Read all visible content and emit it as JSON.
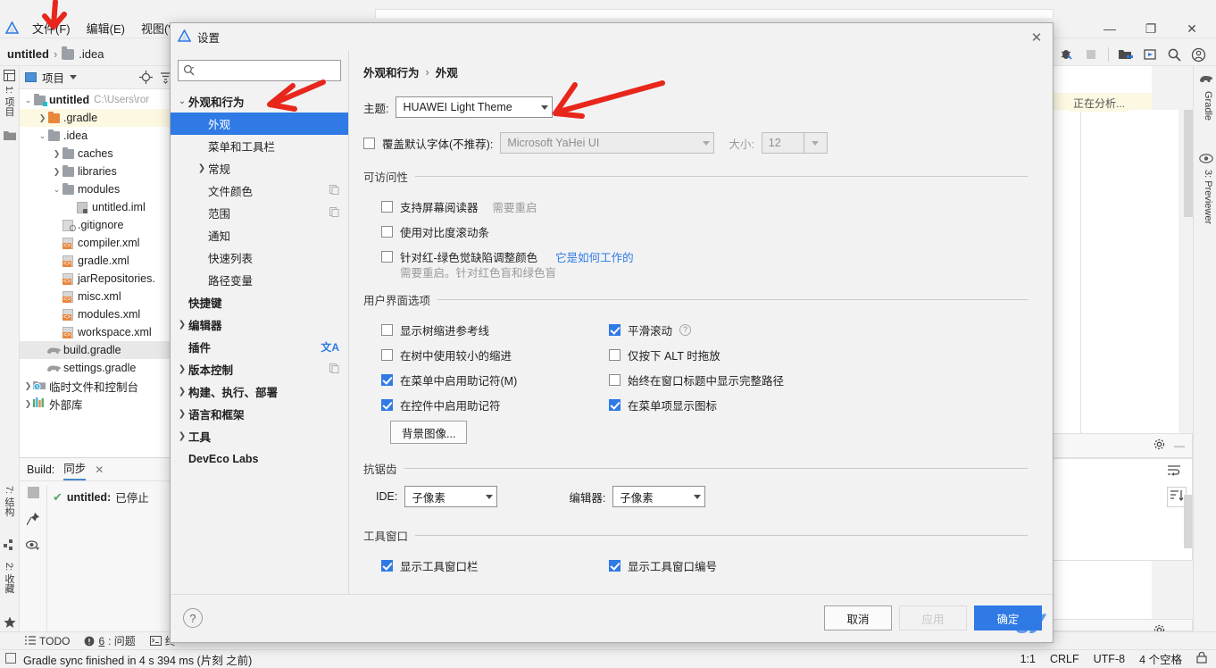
{
  "app": {
    "menus": [
      "文件(F)",
      "编辑(E)",
      "视图(V)"
    ],
    "breadcrumb": {
      "project": "untitled",
      "sep": "›",
      "folder": ".idea"
    },
    "window_controls": {
      "minimize": "—",
      "maximize": "❐",
      "close": "✕"
    }
  },
  "left_strip": {
    "tabs": [
      "1: 项目",
      "7: 结构",
      "2: 收藏"
    ]
  },
  "project_panel": {
    "title": "项目",
    "tree": [
      {
        "label": "untitled",
        "sub": "C:\\Users\\ror",
        "depth": 0,
        "arrow": "v",
        "icon": "folder-module",
        "bold": true
      },
      {
        "label": ".gradle",
        "depth": 1,
        "arrow": ">",
        "icon": "folder-orange",
        "highlight": true
      },
      {
        "label": ".idea",
        "depth": 1,
        "arrow": "v",
        "icon": "folder"
      },
      {
        "label": "caches",
        "depth": 2,
        "arrow": ">",
        "icon": "folder"
      },
      {
        "label": "libraries",
        "depth": 2,
        "arrow": ">",
        "icon": "folder"
      },
      {
        "label": "modules",
        "depth": 2,
        "arrow": "v",
        "icon": "folder"
      },
      {
        "label": "untitled.iml",
        "depth": 3,
        "arrow": "",
        "icon": "module"
      },
      {
        "label": ".gitignore",
        "depth": 2,
        "arrow": "",
        "icon": "file"
      },
      {
        "label": "compiler.xml",
        "depth": 2,
        "arrow": "",
        "icon": "xml"
      },
      {
        "label": "gradle.xml",
        "depth": 2,
        "arrow": "",
        "icon": "xml"
      },
      {
        "label": "jarRepositories.",
        "depth": 2,
        "arrow": "",
        "icon": "xml"
      },
      {
        "label": "misc.xml",
        "depth": 2,
        "arrow": "",
        "icon": "xml"
      },
      {
        "label": "modules.xml",
        "depth": 2,
        "arrow": "",
        "icon": "xml"
      },
      {
        "label": "workspace.xml",
        "depth": 2,
        "arrow": "",
        "icon": "xml"
      },
      {
        "label": "build.gradle",
        "depth": 1,
        "arrow": "",
        "icon": "gradle",
        "selected": true
      },
      {
        "label": "settings.gradle",
        "depth": 1,
        "arrow": "",
        "icon": "gradle"
      },
      {
        "label": "临时文件和控制台",
        "depth": 0,
        "arrow": ">",
        "icon": "scratch"
      },
      {
        "label": "外部库",
        "depth": 0,
        "arrow": ">",
        "icon": "lib"
      }
    ]
  },
  "build_panel": {
    "title": "Build:",
    "tab": "同步",
    "close": "✕",
    "result": {
      "name": "untitled:",
      "status": "已停止"
    }
  },
  "editor": {
    "analyzing": "正在分析..."
  },
  "right_strip": {
    "tabs": [
      "Gradle",
      "3: Previewer"
    ]
  },
  "status_bar_tools": {
    "todo": "TODO",
    "problems": {
      "count": "6",
      "label": ": 问题"
    },
    "terminal": "终"
  },
  "status_bar": {
    "message": "Gradle sync finished in 4 s 394 ms (片刻 之前)",
    "caret": "1:1",
    "line_sep": "CRLF",
    "encoding": "UTF-8",
    "indent": "4 个空格"
  },
  "dialog": {
    "title": "设置",
    "close": "✕",
    "search": {
      "placeholder": "",
      "value": ""
    },
    "nav": [
      {
        "label": "外观和行为",
        "arrow": "v",
        "indent": 0,
        "bold": true
      },
      {
        "label": "外观",
        "arrow": "",
        "indent": 1,
        "selected": true
      },
      {
        "label": "菜单和工具栏",
        "arrow": "",
        "indent": 1
      },
      {
        "label": "常规",
        "arrow": ">",
        "indent": 1
      },
      {
        "label": "文件颜色",
        "arrow": "",
        "indent": 1,
        "badge": "copy"
      },
      {
        "label": "范围",
        "arrow": "",
        "indent": 1,
        "badge": "copy"
      },
      {
        "label": "通知",
        "arrow": "",
        "indent": 1
      },
      {
        "label": "快速列表",
        "arrow": "",
        "indent": 1
      },
      {
        "label": "路径变量",
        "arrow": "",
        "indent": 1
      },
      {
        "label": "快捷键",
        "arrow": "",
        "indent": 0,
        "bold": true
      },
      {
        "label": "编辑器",
        "arrow": ">",
        "indent": 0,
        "bold": true
      },
      {
        "label": "插件",
        "arrow": "",
        "indent": 0,
        "bold": true,
        "badge": "translate"
      },
      {
        "label": "版本控制",
        "arrow": ">",
        "indent": 0,
        "bold": true,
        "badge": "copy"
      },
      {
        "label": "构建、执行、部署",
        "arrow": ">",
        "indent": 0,
        "bold": true
      },
      {
        "label": "语言和框架",
        "arrow": ">",
        "indent": 0,
        "bold": true
      },
      {
        "label": "工具",
        "arrow": ">",
        "indent": 0,
        "bold": true
      },
      {
        "label": "DevEco Labs",
        "arrow": "",
        "indent": 0,
        "bold": true
      }
    ],
    "breadcrumb": {
      "parent": "外观和行为",
      "sep": "›",
      "current": "外观"
    },
    "theme": {
      "label": "主题:",
      "value": "HUAWEI Light Theme"
    },
    "override_font": {
      "checkbox_label": "覆盖默认字体(不推荐):",
      "checked": false,
      "font_value": "Microsoft YaHei UI",
      "size_label": "大小:",
      "size_value": "12"
    },
    "accessibility": {
      "title": "可访问性",
      "items": [
        {
          "label": "支持屏幕阅读器",
          "checked": false,
          "note": "需要重启"
        },
        {
          "label": "使用对比度滚动条",
          "checked": false
        },
        {
          "label": "针对红-绿色觉缺陷调整颜色",
          "checked": false,
          "link": "它是如何工作的",
          "hint": "需要重启。针对红色盲和绿色盲"
        }
      ]
    },
    "ui_options": {
      "title": "用户界面选项",
      "left": [
        {
          "label": "显示树缩进参考线",
          "checked": false
        },
        {
          "label": "在树中使用较小的缩进",
          "checked": false
        },
        {
          "label": "在菜单中启用助记符(M)",
          "checked": true
        },
        {
          "label": "在控件中启用助记符",
          "checked": true
        }
      ],
      "right": [
        {
          "label": "平滑滚动",
          "checked": true,
          "help": "?"
        },
        {
          "label": "仅按下 ALT 时拖放",
          "checked": false
        },
        {
          "label": "始终在窗口标题中显示完整路径",
          "checked": false
        },
        {
          "label": "在菜单项显示图标",
          "checked": true
        }
      ],
      "background_button": "背景图像..."
    },
    "antialiasing": {
      "title": "抗锯齿",
      "ide": {
        "label": "IDE:",
        "value": "子像素"
      },
      "editor": {
        "label": "编辑器:",
        "value": "子像素"
      }
    },
    "tool_window": {
      "title": "工具窗口",
      "left": {
        "label": "显示工具窗口栏",
        "checked": true
      },
      "right": {
        "label": "显示工具窗口编号",
        "checked": true
      }
    },
    "footer": {
      "help": "?",
      "cancel": "取消",
      "apply": "应用",
      "ok": "确定"
    }
  },
  "colors": {
    "accent": "#2f7ae5",
    "selection": "#2f7ae5",
    "highlight_row": "#fcf8e2",
    "annotation_red": "#e8261c",
    "green_check": "#59a869"
  },
  "watermark": {
    "text": "gy"
  }
}
